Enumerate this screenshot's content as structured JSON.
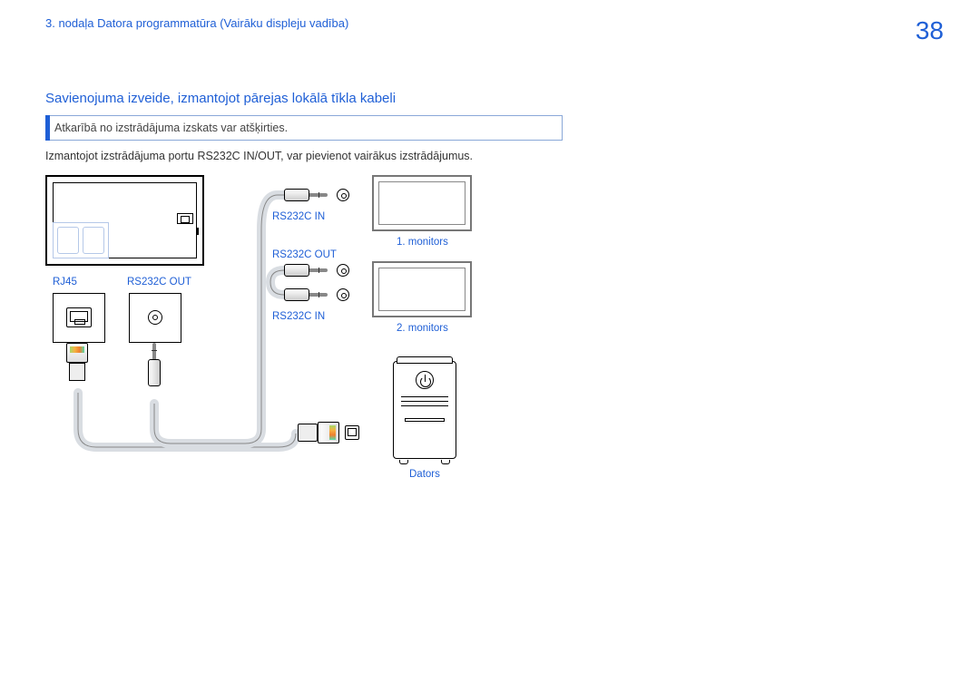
{
  "header": {
    "breadcrumb": "3. nodaļa Datora programmatūra (Vairāku displeju vadība)",
    "page_number": "38"
  },
  "section": {
    "title": "Savienojuma izveide, izmantojot pārejas lokālā tīkla kabeli",
    "note": "Atkarībā no izstrādājuma izskats var atšķirties.",
    "body": "Izmantojot izstrādājuma portu RS232C IN/OUT, var pievienot vairākus izstrādājumus."
  },
  "labels": {
    "rj45": "RJ45",
    "rs232c_out": "RS232C OUT",
    "rs232c_in_1": "RS232C IN",
    "rs232c_out_2": "RS232C OUT",
    "rs232c_in_2": "RS232C IN",
    "monitor1": "1. monitors",
    "monitor2": "2. monitors",
    "computer": "Dators"
  }
}
